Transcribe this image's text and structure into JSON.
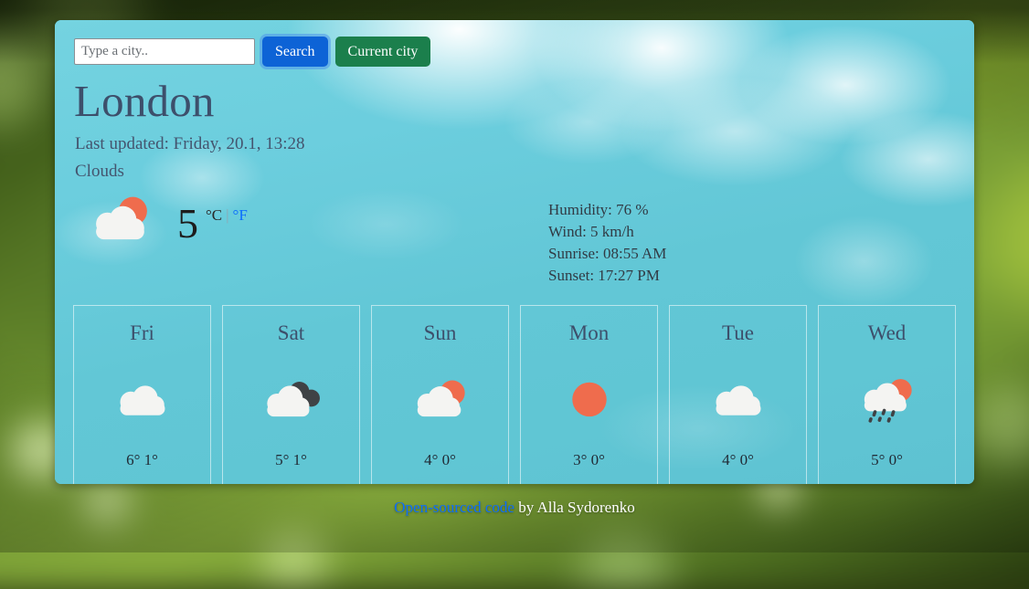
{
  "search": {
    "placeholder": "Type a city..",
    "value": "",
    "search_label": "Search",
    "current_city_label": "Current city"
  },
  "current": {
    "city": "London",
    "last_updated": "Last updated: Friday, 20.1, 13:28",
    "description": "Clouds",
    "temperature": "5",
    "unit_celsius": "°C",
    "unit_separator": "|",
    "unit_fahrenheit": "°F",
    "icon": "cloud-sun-icon",
    "details": {
      "humidity": "Humidity: 76 %",
      "wind": "Wind: 5 km/h",
      "sunrise": "Sunrise: 08:55 AM",
      "sunset": "Sunset: 17:27 PM"
    }
  },
  "forecast": [
    {
      "day": "Fri",
      "icon": "cloud-icon",
      "temps": "6° 1°",
      "high": 6,
      "low": 1
    },
    {
      "day": "Sat",
      "icon": "broken-clouds-icon",
      "temps": "5° 1°",
      "high": 5,
      "low": 1
    },
    {
      "day": "Sun",
      "icon": "cloud-sun-icon",
      "temps": "4° 0°",
      "high": 4,
      "low": 0
    },
    {
      "day": "Mon",
      "icon": "sun-icon",
      "temps": "3° 0°",
      "high": 3,
      "low": 0
    },
    {
      "day": "Tue",
      "icon": "cloud-icon",
      "temps": "4° 0°",
      "high": 4,
      "low": 0
    },
    {
      "day": "Wed",
      "icon": "cloud-sun-rain-icon",
      "temps": "5° 0°",
      "high": 5,
      "low": 0
    }
  ],
  "footer": {
    "link_label": "Open-sourced code",
    "author_text": " by Alla Sydorenko"
  },
  "colors": {
    "primary_button": "#0d63d6",
    "success_button": "#1b7f4c",
    "link": "#0d6efd",
    "heading": "#3d4f6b",
    "panel_sky": "#63c9d8",
    "sun": "#ef6c4d",
    "cloud": "#f4f4f2",
    "dark_cloud": "#3f4245"
  }
}
